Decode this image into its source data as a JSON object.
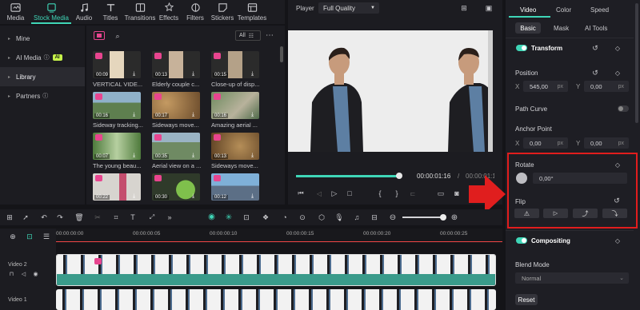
{
  "toolbar": {
    "items": [
      {
        "label": "Media",
        "icon": "media-icon"
      },
      {
        "label": "Stock Media",
        "icon": "stock-media-icon",
        "active": true
      },
      {
        "label": "Audio",
        "icon": "audio-icon"
      },
      {
        "label": "Titles",
        "icon": "titles-icon"
      },
      {
        "label": "Transitions",
        "icon": "transitions-icon"
      },
      {
        "label": "Effects",
        "icon": "effects-icon"
      },
      {
        "label": "Filters",
        "icon": "filters-icon"
      },
      {
        "label": "Stickers",
        "icon": "stickers-icon"
      },
      {
        "label": "Templates",
        "icon": "templates-icon"
      }
    ]
  },
  "leftnav": {
    "items": [
      {
        "label": "Mine"
      },
      {
        "label": "AI Media",
        "badge": "AI"
      },
      {
        "label": "Library"
      },
      {
        "label": "Partners"
      }
    ]
  },
  "media": {
    "filter_label": "All",
    "cards": [
      {
        "title": "VERTICAL VIDE...",
        "duration": "00:09"
      },
      {
        "title": "Elderly couple c...",
        "duration": "00:13"
      },
      {
        "title": "Close-up of disp...",
        "duration": "00:15"
      },
      {
        "title": "Sideway tracking...",
        "duration": "00:16"
      },
      {
        "title": "Sideways move...",
        "duration": "00:17"
      },
      {
        "title": "Amazing aerial ...",
        "duration": "00:16"
      },
      {
        "title": "The young beau...",
        "duration": "00:07"
      },
      {
        "title": "Aerial view on a ...",
        "duration": "00:35"
      },
      {
        "title": "Sideways move...",
        "duration": "00:13"
      },
      {
        "title": "",
        "duration": "00:22"
      },
      {
        "title": "",
        "duration": "00:30"
      },
      {
        "title": "",
        "duration": "00:12"
      }
    ]
  },
  "player": {
    "label": "Player",
    "quality": "Full Quality",
    "current_time": "00:00:01:16",
    "separator": "/",
    "total_time": "00:00:01:16",
    "progress": 0.98
  },
  "timeline": {
    "ticks": [
      "00:00:00:00",
      "00:00:00:05",
      "00:00:00:10",
      "00:00:00:15",
      "00:00:00:20",
      "00:00:00:25"
    ],
    "tracks": [
      {
        "label": "Video 2"
      },
      {
        "label": "Video 1"
      }
    ]
  },
  "props": {
    "tabs": [
      "Video",
      "Color",
      "Speed"
    ],
    "subtabs": [
      "Basic",
      "Mask",
      "AI Tools"
    ],
    "transform_label": "Transform",
    "position_label": "Position",
    "pos_x_label": "X",
    "pos_x": "545,00",
    "pos_y_label": "Y",
    "pos_y": "0,00",
    "unit": "px",
    "path_curve_label": "Path Curve",
    "anchor_label": "Anchor Point",
    "anc_x_label": "X",
    "anc_x": "0,00",
    "anc_y_label": "Y",
    "anc_y": "0,00",
    "rotate_label": "Rotate",
    "rotate_value": "0,00°",
    "flip_label": "Flip",
    "compositing_label": "Compositing",
    "blend_label": "Blend Mode",
    "blend_value": "Normal",
    "reset_label": "Reset"
  },
  "colors": {
    "accent": "#3fd6b7",
    "highlight": "#e11d1d",
    "brand_pink": "#e8458f"
  }
}
